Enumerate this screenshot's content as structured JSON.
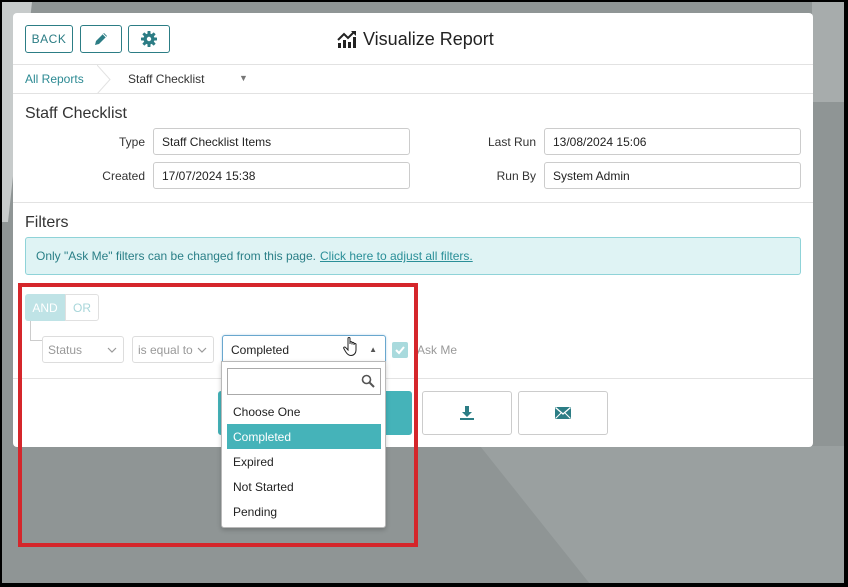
{
  "header": {
    "back_label": "BACK",
    "title": "Visualize Report",
    "edit_icon": "pencil-icon",
    "settings_icon": "gear-icon",
    "title_icon": "chart-line-icon"
  },
  "breadcrumb": {
    "root": "All Reports",
    "current": "Staff Checklist"
  },
  "report": {
    "section_title": "Staff Checklist",
    "type_label": "Type",
    "type_value": "Staff Checklist Items",
    "created_label": "Created",
    "created_value": "17/07/2024 15:38",
    "last_run_label": "Last Run",
    "last_run_value": "13/08/2024 15:06",
    "run_by_label": "Run By",
    "run_by_value": "System Admin"
  },
  "filters": {
    "section_title": "Filters",
    "notice_text": "Only \"Ask Me\" filters can be changed from this page.",
    "notice_link": "Click here to adjust all filters.",
    "and_label": "AND",
    "or_label": "OR",
    "field": "Status",
    "operator": "is equal to",
    "value": "Completed",
    "ask_me_label": "Ask Me",
    "ask_me_checked": true
  },
  "dropdown": {
    "search_value": "",
    "options": [
      "Choose One",
      "Completed",
      "Expired",
      "Not Started",
      "Pending"
    ],
    "selected": "Completed"
  },
  "actions": {
    "download_icon": "download-icon",
    "email_icon": "envelope-icon"
  },
  "colors": {
    "teal": "#45b3b9",
    "accent": "#2c7d85",
    "highlight_box": "#d5262b"
  }
}
